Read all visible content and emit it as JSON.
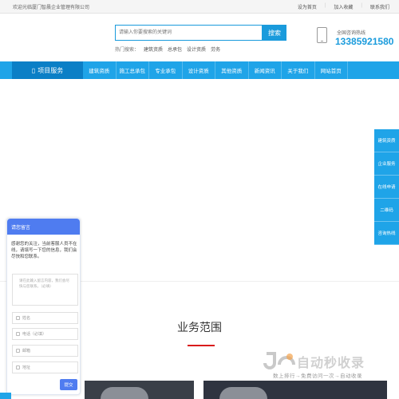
{
  "topbar": {
    "welcome": "欢迎光临厦门智晨企业管理有限公司",
    "links": [
      "设为首页",
      "加入收藏",
      "联系我们"
    ]
  },
  "search": {
    "placeholder": "请输入你要搜索的关键词",
    "button": "搜索",
    "hot_label": "热门搜索：",
    "hot_items": [
      "建筑资质",
      "总承包",
      "设计资质",
      "劳务"
    ]
  },
  "hotline": {
    "label": "全国咨询热线",
    "number": "13385921580"
  },
  "nav": {
    "first": "项目服务",
    "items": [
      "建筑资质",
      "施工总承包",
      "专业承包",
      "设计资质",
      "其他资质",
      "新闻资讯",
      "关于我们",
      "网站首页"
    ]
  },
  "sidebar": [
    "建筑资质",
    "企业服务",
    "在线申请",
    "二维码",
    "咨询热线"
  ],
  "section": {
    "title": "业务范围"
  },
  "message": {
    "title": "请您留言",
    "intro": "感谢您的关注，当前客服人员不在线，请填写一下您的信息，我们会尽快和您联系。",
    "textarea_placeholder": "请在此输入留言内容，我们会尽快与您联系。（必填）",
    "name": "姓名",
    "phone": "电话（必填）",
    "email": "邮箱",
    "address": "地址",
    "submit": "提交"
  },
  "watermark": {
    "brand": "自动秒收录",
    "slogan": "数上排行→免费访问一次→自动收录"
  },
  "colors": {
    "primary": "#1fa4e8",
    "nav_dark": "#0b7fc6",
    "accent_red": "#d91c1c",
    "chat_blue": "#4f7cf0"
  }
}
